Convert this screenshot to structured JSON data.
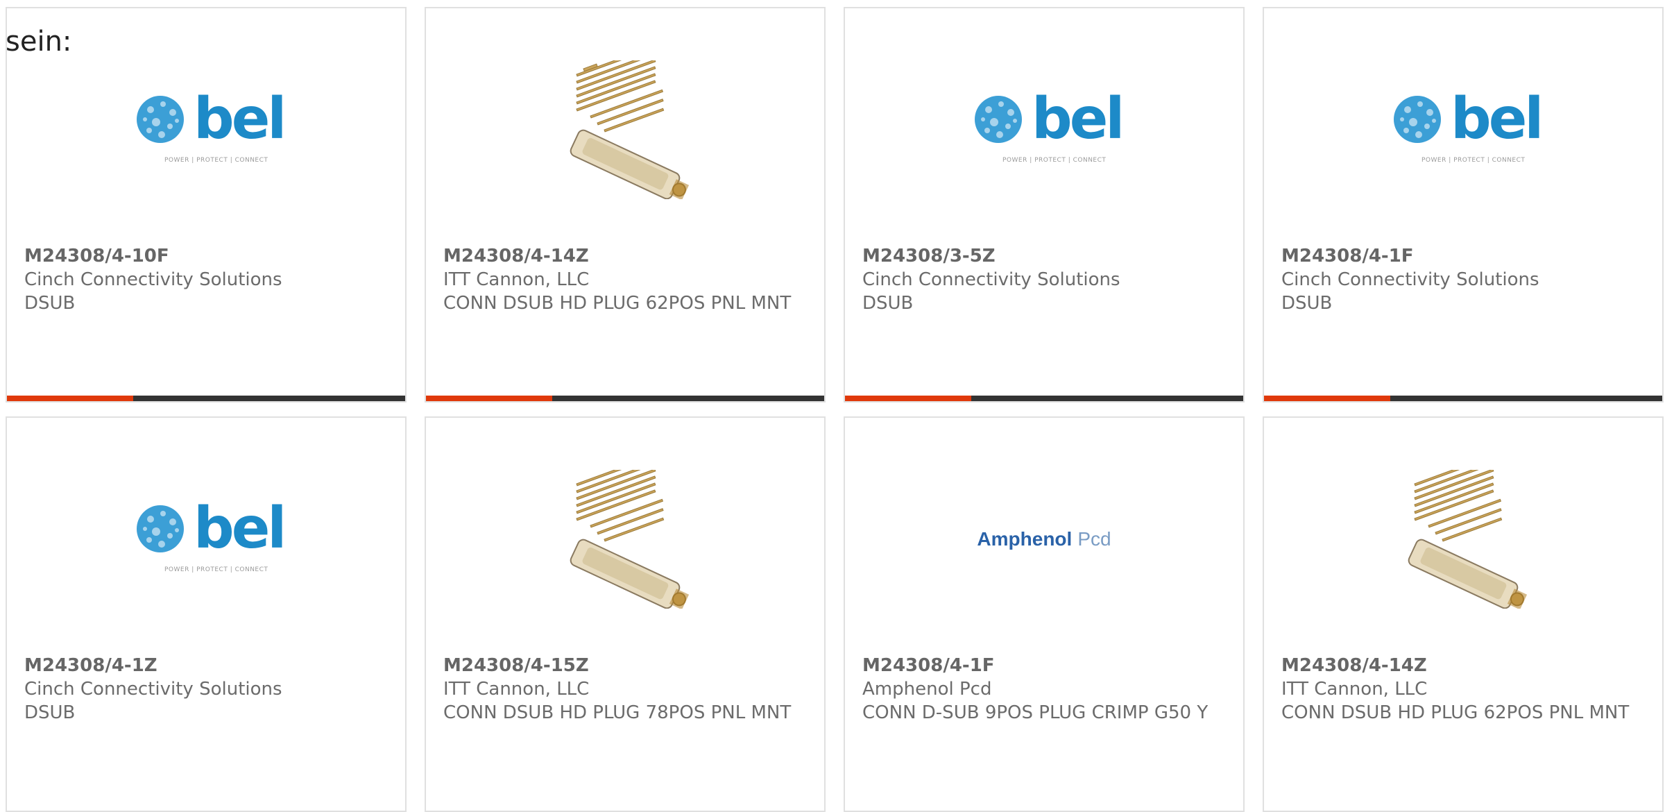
{
  "intro": {
    "text": "sein:"
  },
  "products": [
    {
      "part_number": "M24308/4-10F",
      "manufacturer": "Cinch Connectivity Solutions",
      "description": "DSUB",
      "image": "bel-logo",
      "logo_word": "bel",
      "logo_tagline": "POWER | PROTECT | CONNECT"
    },
    {
      "part_number": "M24308/4-14Z",
      "manufacturer": "ITT Cannon, LLC",
      "description": "CONN DSUB HD PLUG 62POS PNL MNT",
      "image": "dsub-connector-photo"
    },
    {
      "part_number": "M24308/3-5Z",
      "manufacturer": "Cinch Connectivity Solutions",
      "description": "DSUB",
      "image": "bel-logo",
      "logo_word": "bel",
      "logo_tagline": "POWER | PROTECT | CONNECT"
    },
    {
      "part_number": "M24308/4-1F",
      "manufacturer": "Cinch Connectivity Solutions",
      "description": "DSUB",
      "image": "bel-logo",
      "logo_word": "bel",
      "logo_tagline": "POWER | PROTECT | CONNECT"
    },
    {
      "part_number": "M24308/4-1Z",
      "manufacturer": "Cinch Connectivity Solutions",
      "description": "DSUB",
      "image": "bel-logo",
      "logo_word": "bel",
      "logo_tagline": "POWER | PROTECT | CONNECT"
    },
    {
      "part_number": "M24308/4-15Z",
      "manufacturer": "ITT Cannon, LLC",
      "description": "CONN DSUB HD PLUG 78POS PNL MNT",
      "image": "dsub-connector-photo"
    },
    {
      "part_number": "M24308/4-1F",
      "manufacturer": "Amphenol Pcd",
      "description": "CONN D-SUB 9POS PLUG CRIMP G50 Y",
      "image": "amphenol-logo",
      "logo_word_a": "Amphenol",
      "logo_word_b": "Pcd"
    },
    {
      "part_number": "M24308/4-14Z",
      "manufacturer": "ITT Cannon, LLC",
      "description": "CONN DSUB HD PLUG 62POS PNL MNT",
      "image": "dsub-connector-photo"
    }
  ],
  "colors": {
    "accent": "#e0390b",
    "bar": "#333333",
    "bel_blue": "#1d8ac8",
    "amphenol_blue": "#2a62a8",
    "text_gray": "#6b6b6b"
  }
}
